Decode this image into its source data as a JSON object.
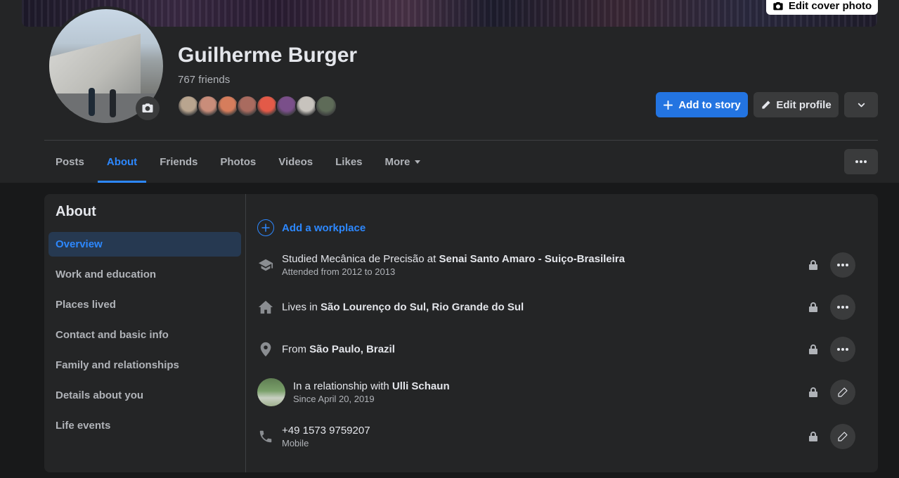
{
  "cover": {
    "edit_cover_label": "Edit cover photo"
  },
  "profile": {
    "name": "Guilherme Burger",
    "friends_count": "767 friends",
    "facepile_colors": [
      "#b9a58f",
      "#c98d7a",
      "#d67d5c",
      "#a96b5f",
      "#e35a48",
      "#7a4f8a",
      "#c7c3bd",
      "#5e6b58"
    ]
  },
  "actions": {
    "add_to_story": "Add to story",
    "edit_profile": "Edit profile"
  },
  "tabs": [
    {
      "label": "Posts"
    },
    {
      "label": "About"
    },
    {
      "label": "Friends"
    },
    {
      "label": "Photos"
    },
    {
      "label": "Videos"
    },
    {
      "label": "Likes"
    },
    {
      "label": "More"
    }
  ],
  "about": {
    "title": "About",
    "sidebar": [
      {
        "label": "Overview"
      },
      {
        "label": "Work and education"
      },
      {
        "label": "Places lived"
      },
      {
        "label": "Contact and basic info"
      },
      {
        "label": "Family and relationships"
      },
      {
        "label": "Details about you"
      },
      {
        "label": "Life events"
      }
    ],
    "add_workplace": "Add a workplace",
    "education": {
      "prefix": "Studied Mecânica de Precisão at ",
      "school": "Senai Santo Amaro - Suiço-Brasileira",
      "sub": "Attended from 2012 to 2013"
    },
    "lives": {
      "prefix": "Lives in ",
      "place": "São Lourenço do Sul, Rio Grande do Sul"
    },
    "from": {
      "prefix": "From ",
      "place": "São Paulo, Brazil"
    },
    "relationship": {
      "prefix": "In a relationship with ",
      "partner": "Ulli Schaun",
      "sub": "Since April 20, 2019"
    },
    "phone": {
      "number": "+49 1573 9759207",
      "sub": "Mobile"
    }
  },
  "colors": {
    "accent": "#2d88ff",
    "primary_button": "#2374e1",
    "surface": "#242526",
    "background": "#18191a"
  }
}
